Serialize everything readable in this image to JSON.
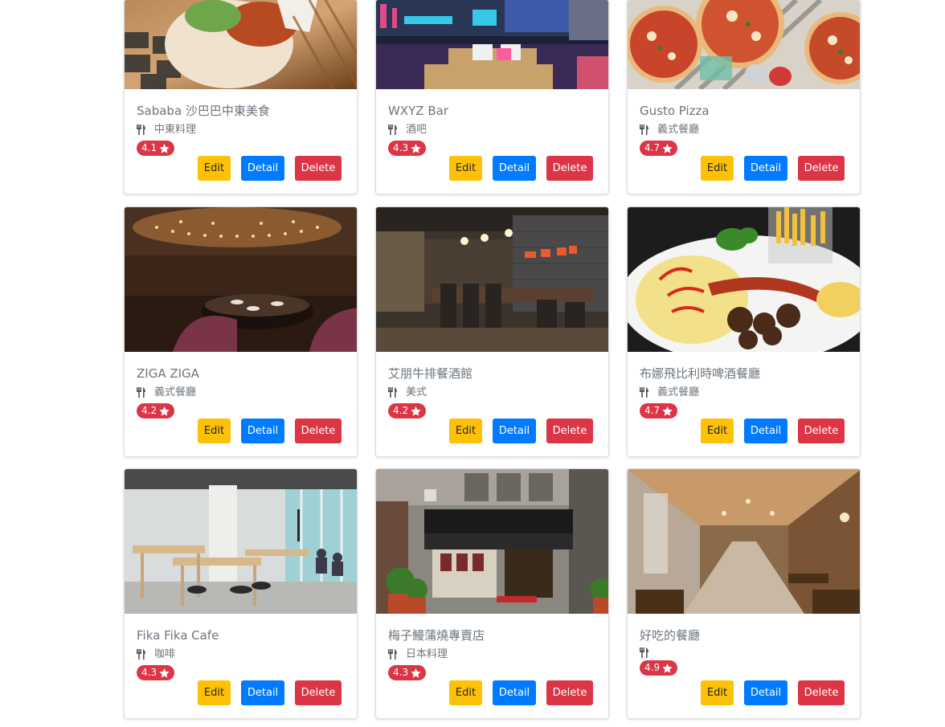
{
  "buttons": {
    "edit": "Edit",
    "detail": "Detail",
    "delete": "Delete"
  },
  "colors": {
    "edit": "#ffc107",
    "detail": "#007bff",
    "delete": "#dc3545",
    "text": "#6c757d"
  },
  "restaurants": [
    {
      "name": "Sababa 沙巴巴中東美食",
      "category": "中東料理",
      "rating": "4.1",
      "image": "falafel-pita-photo"
    },
    {
      "name": "WXYZ Bar",
      "category": "酒吧",
      "rating": "4.3",
      "image": "colorful-bar-lounge-photo"
    },
    {
      "name": "Gusto Pizza",
      "category": "義式餐廳",
      "rating": "4.7",
      "image": "pizzas-on-table-photo"
    },
    {
      "name": "ZIGA ZIGA",
      "category": "義式餐廳",
      "rating": "4.2",
      "image": "restaurant-interior-lights-photo"
    },
    {
      "name": "艾朋牛排餐酒館",
      "category": "美式",
      "rating": "4.2",
      "image": "long-dining-table-photo"
    },
    {
      "name": "布娜飛比利時啤酒餐廳",
      "category": "義式餐廳",
      "rating": "4.7",
      "image": "omelette-sausage-fries-photo"
    },
    {
      "name": "Fika Fika Cafe",
      "category": "咖啡",
      "rating": "4.3",
      "image": "bright-cafe-interior-photo"
    },
    {
      "name": "梅子鰻蒲燒專賣店",
      "category": "日本料理",
      "rating": "4.3",
      "image": "umeko-storefront-photo"
    },
    {
      "name": "好吃的餐廳",
      "category": "",
      "rating": "4.9",
      "image": "wood-dining-hall-photo"
    }
  ]
}
